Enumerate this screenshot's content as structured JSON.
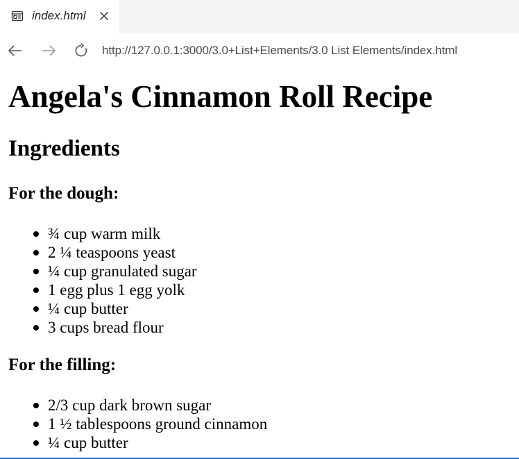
{
  "browser": {
    "tab": {
      "title": "index.html",
      "icon": "page-icon",
      "close_icon": "close-icon"
    },
    "toolbar": {
      "back_icon": "arrow-left-icon",
      "forward_icon": "arrow-right-icon",
      "reload_icon": "reload-icon",
      "url": "http://127.0.0.1:3000/3.0+List+Elements/3.0 List Elements/index.html"
    }
  },
  "page": {
    "title": "Angela's Cinnamon Roll Recipe",
    "section_heading": "Ingredients",
    "dough": {
      "heading": "For the dough:",
      "items": [
        "¾ cup warm milk",
        "2 ¼ teaspoons yeast",
        "¼ cup granulated sugar",
        "1 egg plus 1 egg yolk",
        "¼ cup butter",
        "3 cups bread flour"
      ]
    },
    "filling": {
      "heading": "For the filling:",
      "items": [
        "2/3 cup dark brown sugar",
        "1 ½ tablespoons ground cinnamon",
        "¼ cup butter"
      ]
    }
  },
  "colors": {
    "tabstrip_bg": "#f3f3f3",
    "accent_line": "#2b78d0"
  }
}
